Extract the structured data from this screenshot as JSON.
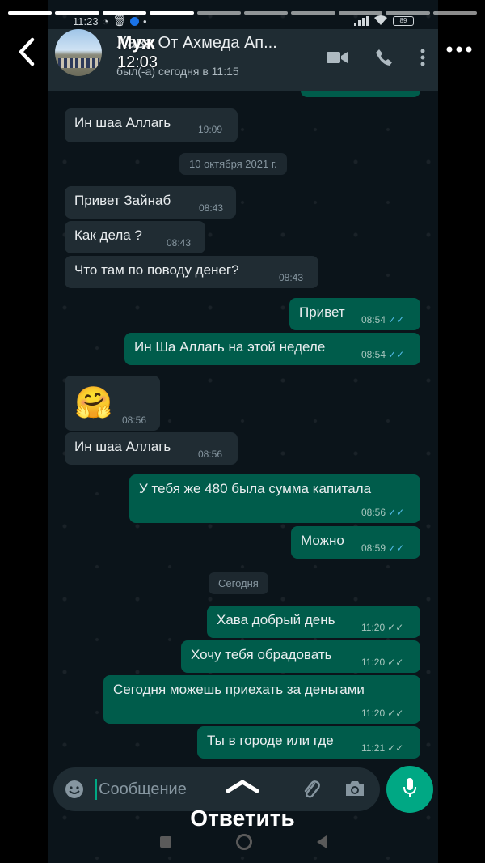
{
  "story": {
    "segments": 10,
    "completed": 4,
    "user": "Муж",
    "time": "12:03",
    "reply_label": "Ответить"
  },
  "status_bar": {
    "time": "11:23",
    "battery": "89"
  },
  "chat": {
    "title": "Хава От Ахмеда Ап...",
    "subtitle": "был(-а) сегодня в 11:15"
  },
  "messages": [
    {
      "dir": "in",
      "text": "Ин шаа Аллагь",
      "time": "19:09"
    },
    {
      "type": "date",
      "text": "10 октября 2021 г."
    },
    {
      "dir": "in",
      "text": "Привет Зайнаб",
      "time": "08:43"
    },
    {
      "dir": "in",
      "text": "Как дела ?",
      "time": "08:43"
    },
    {
      "dir": "in",
      "text": "Что там по поводу денег?",
      "time": "08:43"
    },
    {
      "dir": "out",
      "text": "Привет",
      "time": "08:54",
      "status": "read"
    },
    {
      "dir": "out",
      "text": "Ин Ша Аллагь на этой неделе",
      "time": "08:54",
      "status": "read"
    },
    {
      "dir": "in",
      "text": "🤗",
      "time": "08:56",
      "emoji": true
    },
    {
      "dir": "in",
      "text": "Ин шаа Аллагь",
      "time": "08:56"
    },
    {
      "dir": "out",
      "text": "У тебя же 480 была сумма капитала",
      "time": "08:56",
      "status": "read"
    },
    {
      "dir": "out",
      "text": "Можно",
      "time": "08:59",
      "status": "read"
    },
    {
      "type": "date",
      "text": "Сегодня"
    },
    {
      "dir": "out",
      "text": "Хава добрый день",
      "time": "11:20",
      "status": "sent"
    },
    {
      "dir": "out",
      "text": "Хочу тебя обрадовать",
      "time": "11:20",
      "status": "sent"
    },
    {
      "dir": "out",
      "text": "Сегодня можешь приехать за деньгами",
      "time": "11:20",
      "status": "sent"
    },
    {
      "dir": "out",
      "text": "Ты в городе или где",
      "time": "11:21",
      "status": "sent"
    }
  ],
  "composer": {
    "placeholder": "Сообщение"
  },
  "icons": {
    "back": "chevron-left-icon",
    "more_story": "more-horizontal-icon",
    "video": "video-call-icon",
    "call": "phone-icon",
    "menu": "more-vertical-icon",
    "emoji": "emoji-icon",
    "attach": "paperclip-icon",
    "camera": "camera-icon",
    "mic": "mic-icon",
    "swipe_up": "chevron-up-icon"
  },
  "colors": {
    "background": "#0b141a",
    "header": "#1f2c33",
    "incoming_bubble": "#202c33",
    "outgoing_bubble": "#005c4b",
    "read_ticks": "#53bdeb",
    "accent": "#00a884"
  }
}
